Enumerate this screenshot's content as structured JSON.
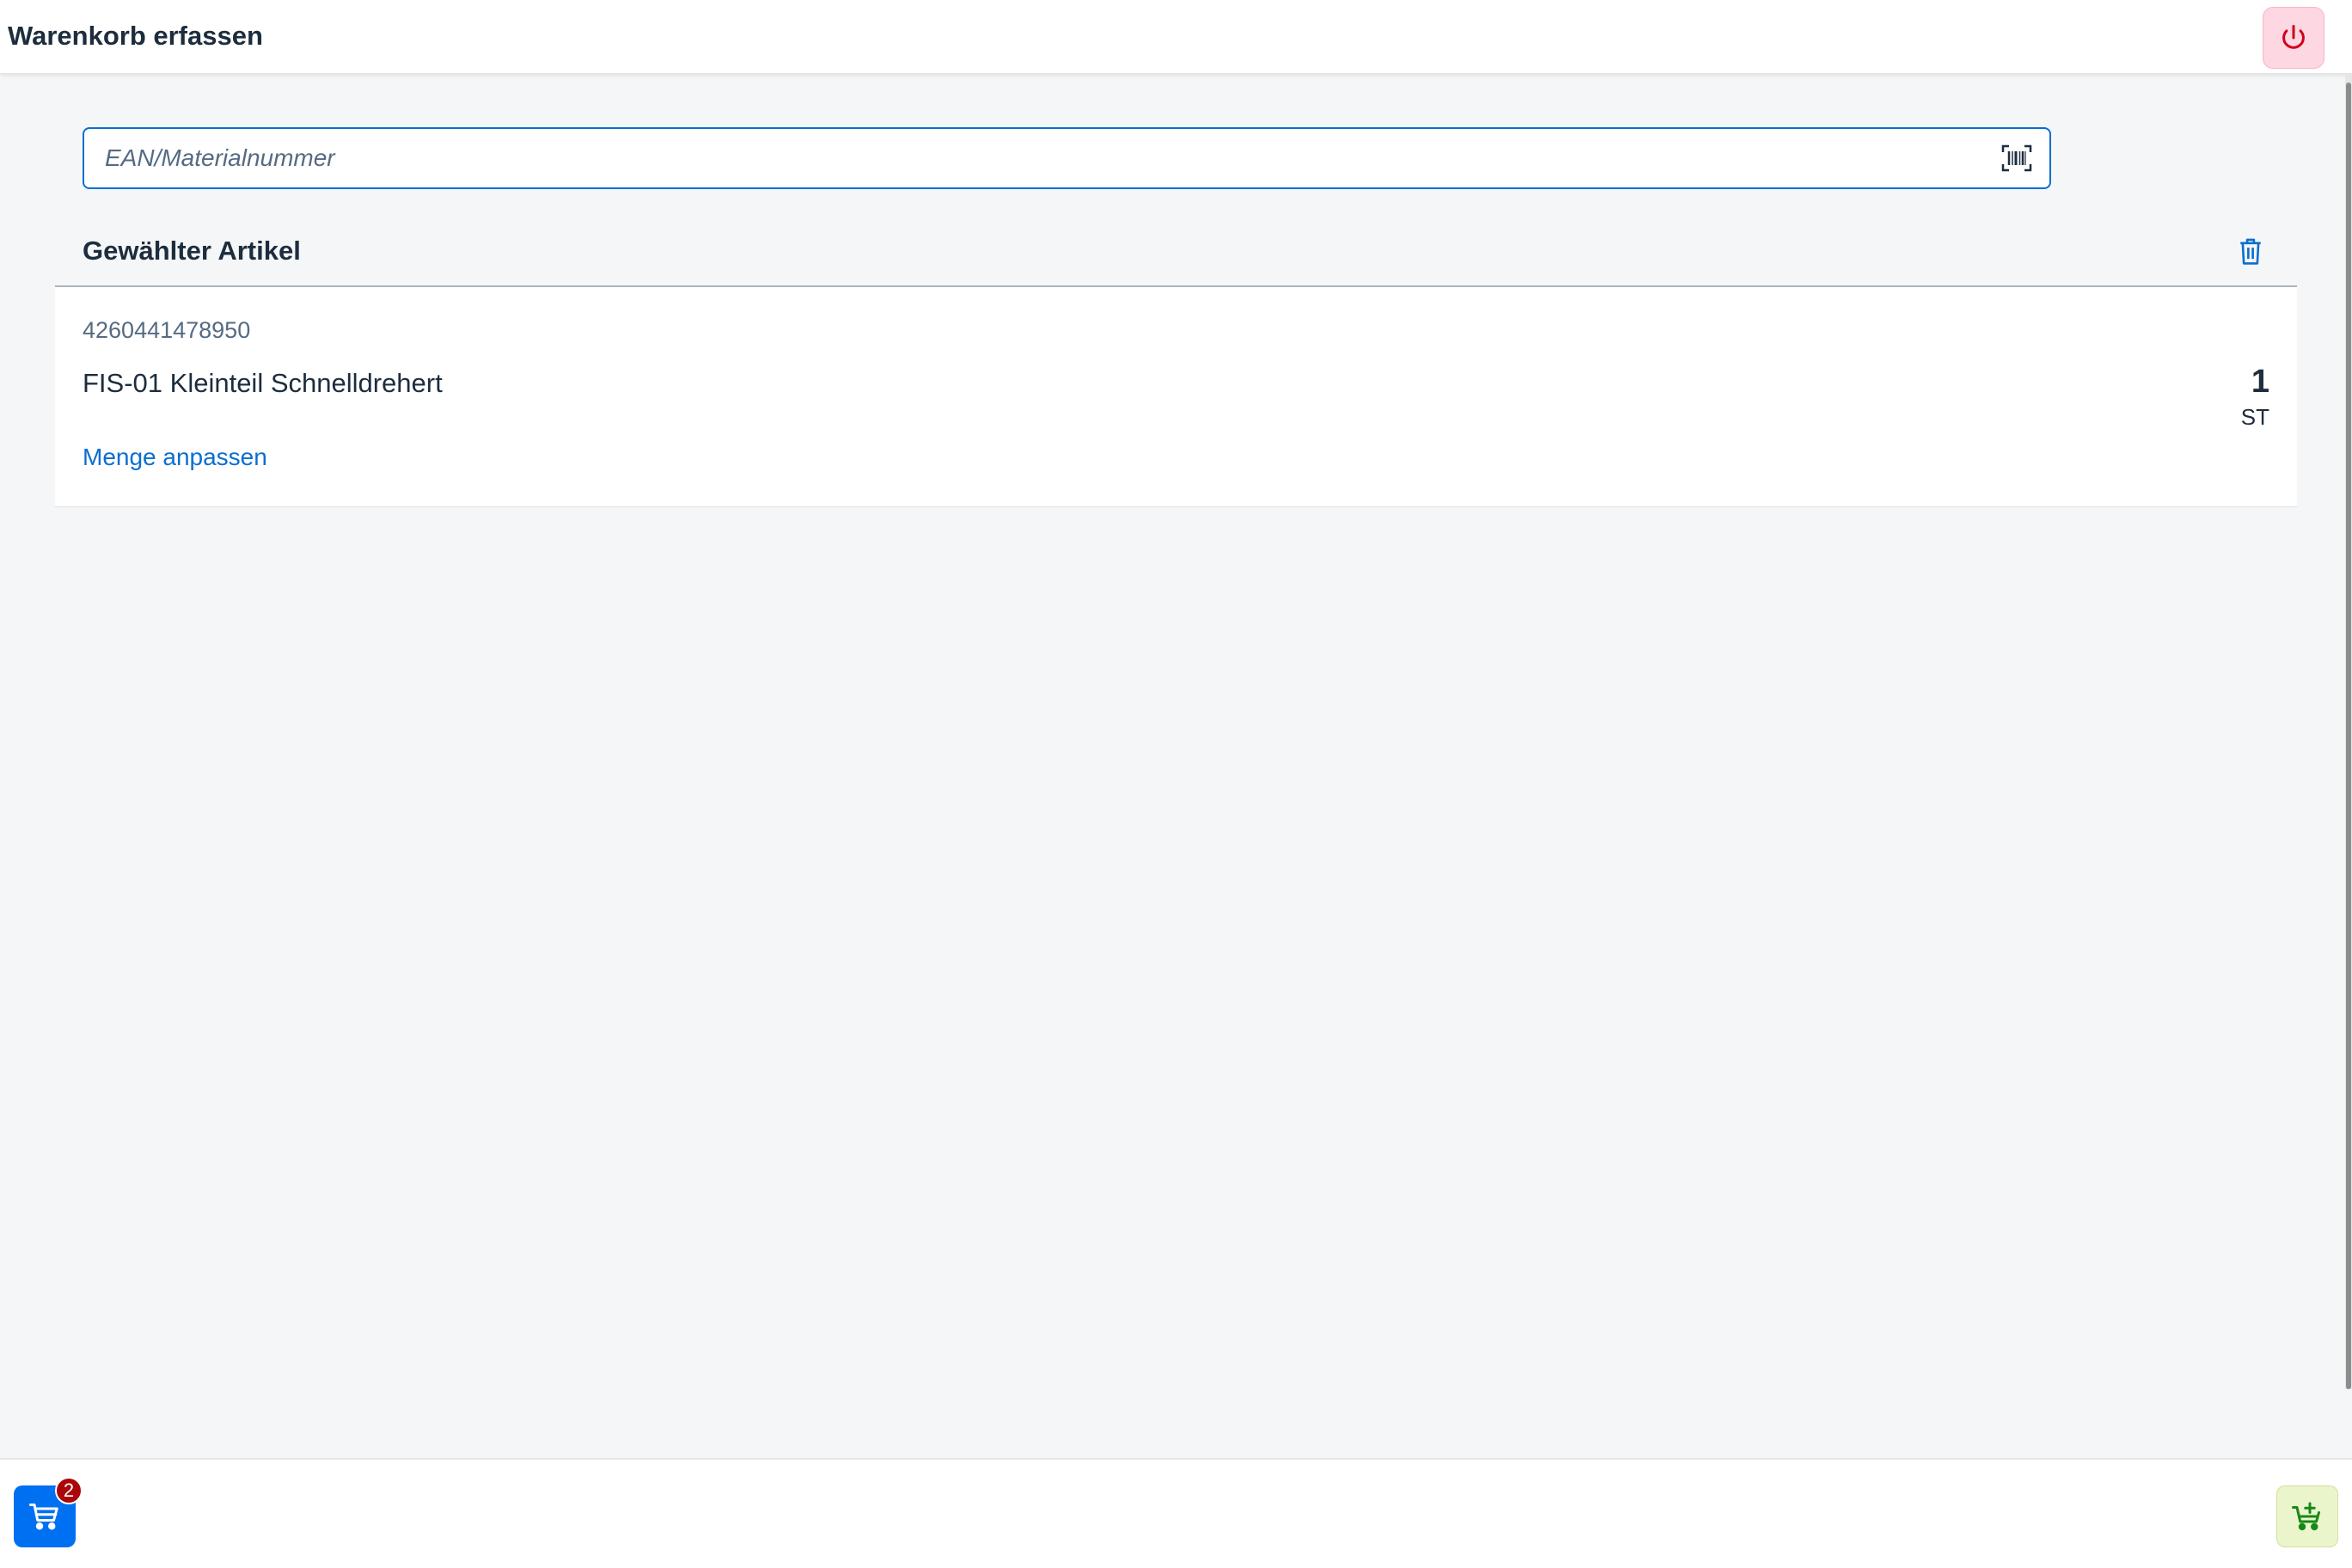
{
  "header": {
    "title": "Warenkorb erfassen",
    "power_icon": "power-icon"
  },
  "search": {
    "value": "",
    "placeholder": "EAN/Materialnummer",
    "scan_icon": "barcode-scan-icon"
  },
  "selected_section": {
    "title": "Gewählter Artikel",
    "delete_icon": "trash-icon"
  },
  "item": {
    "ean": "4260441478950",
    "name": "FIS-01 Kleinteil Schnelldrehert",
    "quantity": "1",
    "unit": "ST",
    "adjust_link": "Menge anpassen"
  },
  "footer": {
    "cart_icon": "cart-icon",
    "cart_count": "2",
    "add_to_cart_icon": "add-to-cart-icon"
  },
  "colors": {
    "accent": "#0a6ed1",
    "cart_button": "#0070f2",
    "badge": "#aa0808",
    "power_bg": "#fdd7e1",
    "power_icon": "#d0021b",
    "add_cart_bg": "#ebf5cb",
    "add_cart_icon": "#188918"
  }
}
